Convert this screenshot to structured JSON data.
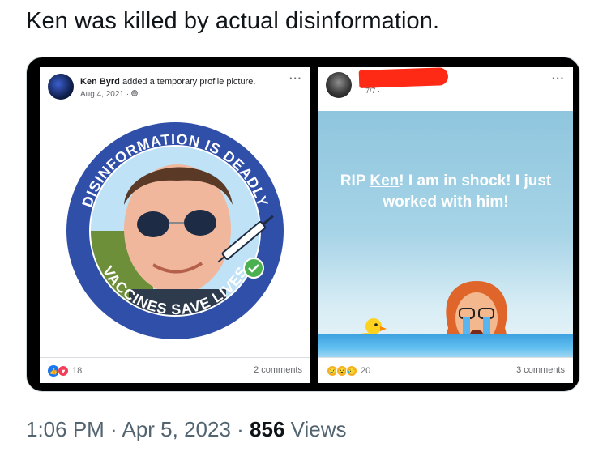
{
  "tweet": {
    "text": "Ken was killed by actual disinformation."
  },
  "left_post": {
    "author": "Ken Byrd",
    "action": " added a temporary profile picture.",
    "date": "Aug 4, 2021 · ",
    "badge_top_text": "DISINFORMATION IS DEADLY",
    "badge_bottom_text": "VACCINES SAVE LIVES",
    "reaction_count": "18",
    "comments": "2 comments"
  },
  "right_post": {
    "date": "7/7 · ",
    "message_prefix": "RIP ",
    "message_link": "Ken",
    "message_suffix": "! I am in shock! I just worked with him!",
    "reaction_count": "20",
    "comments": "3 comments"
  },
  "meta": {
    "time": "1:06 PM",
    "separator": " · ",
    "date": "Apr 5, 2023",
    "separator2": " · ",
    "views_count": "856",
    "views_label": " Views"
  },
  "icons": {
    "more": "more-dots-icon",
    "globe": "globe-icon",
    "like": "like-reaction-icon",
    "love": "love-reaction-icon",
    "cry": "cry-reaction-icon",
    "wow": "wow-reaction-icon",
    "sad": "sad-reaction-icon",
    "syringe": "syringe-icon",
    "check": "check-icon"
  },
  "colors": {
    "badge_blue": "#2f4fa8",
    "redaction": "#ff2a16",
    "facebook_blue": "#1877f2"
  }
}
